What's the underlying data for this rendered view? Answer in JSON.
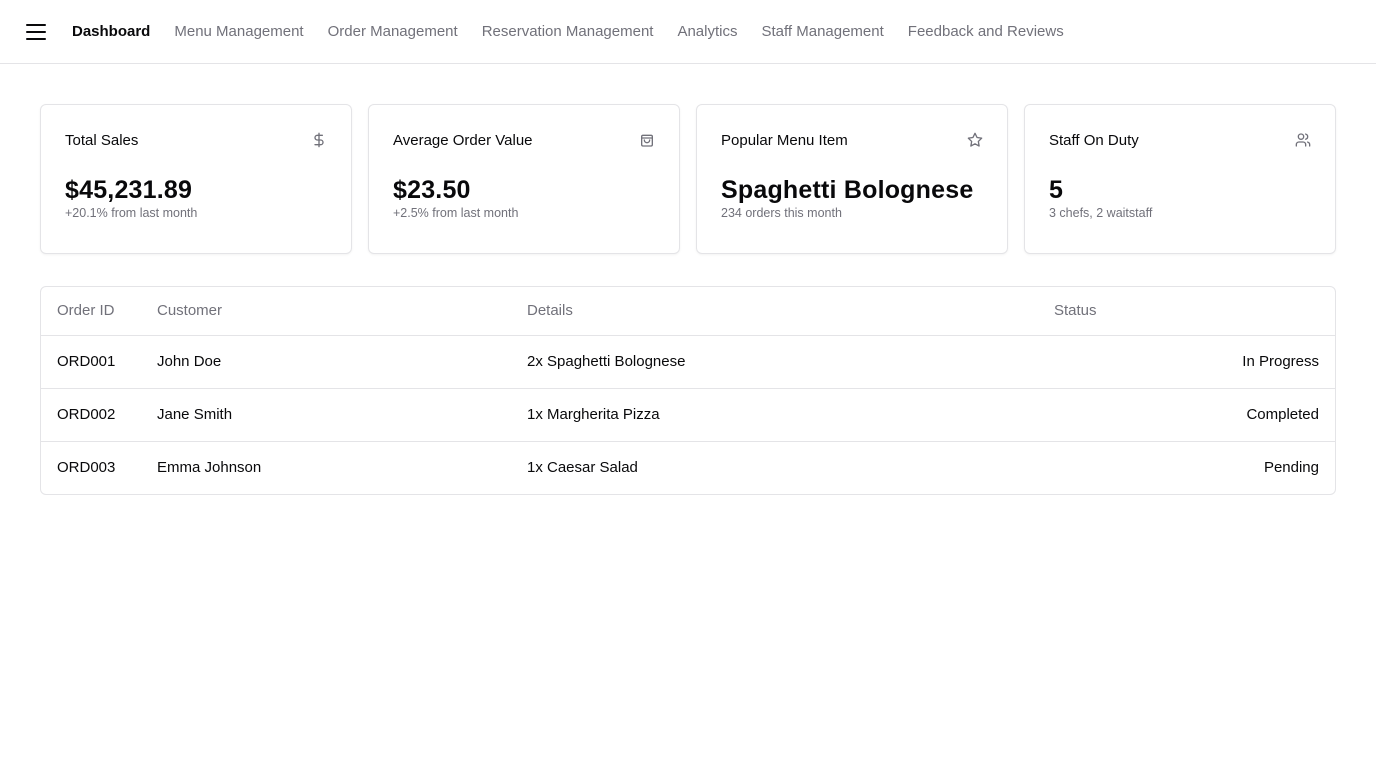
{
  "nav": {
    "items": [
      {
        "label": "Dashboard",
        "active": true
      },
      {
        "label": "Menu Management",
        "active": false
      },
      {
        "label": "Order Management",
        "active": false
      },
      {
        "label": "Reservation Management",
        "active": false
      },
      {
        "label": "Analytics",
        "active": false
      },
      {
        "label": "Staff Management",
        "active": false
      },
      {
        "label": "Feedback and Reviews",
        "active": false
      }
    ]
  },
  "cards": [
    {
      "title": "Total Sales",
      "icon": "dollar-icon",
      "value": "$45,231.89",
      "sub": "+20.1% from last month"
    },
    {
      "title": "Average Order Value",
      "icon": "shopping-bag-icon",
      "value": "$23.50",
      "sub": "+2.5% from last month"
    },
    {
      "title": "Popular Menu Item",
      "icon": "star-icon",
      "value": "Spaghetti Bolognese",
      "sub": "234 orders this month"
    },
    {
      "title": "Staff On Duty",
      "icon": "users-icon",
      "value": "5",
      "sub": "3 chefs, 2 waitstaff"
    }
  ],
  "orders": {
    "headers": {
      "id": "Order ID",
      "customer": "Customer",
      "details": "Details",
      "status": "Status"
    },
    "rows": [
      {
        "id": "ORD001",
        "customer": "John Doe",
        "details": "2x Spaghetti Bolognese",
        "status": "In Progress"
      },
      {
        "id": "ORD002",
        "customer": "Jane Smith",
        "details": "1x Margherita Pizza",
        "status": "Completed"
      },
      {
        "id": "ORD003",
        "customer": "Emma Johnson",
        "details": "1x Caesar Salad",
        "status": "Pending"
      }
    ]
  }
}
